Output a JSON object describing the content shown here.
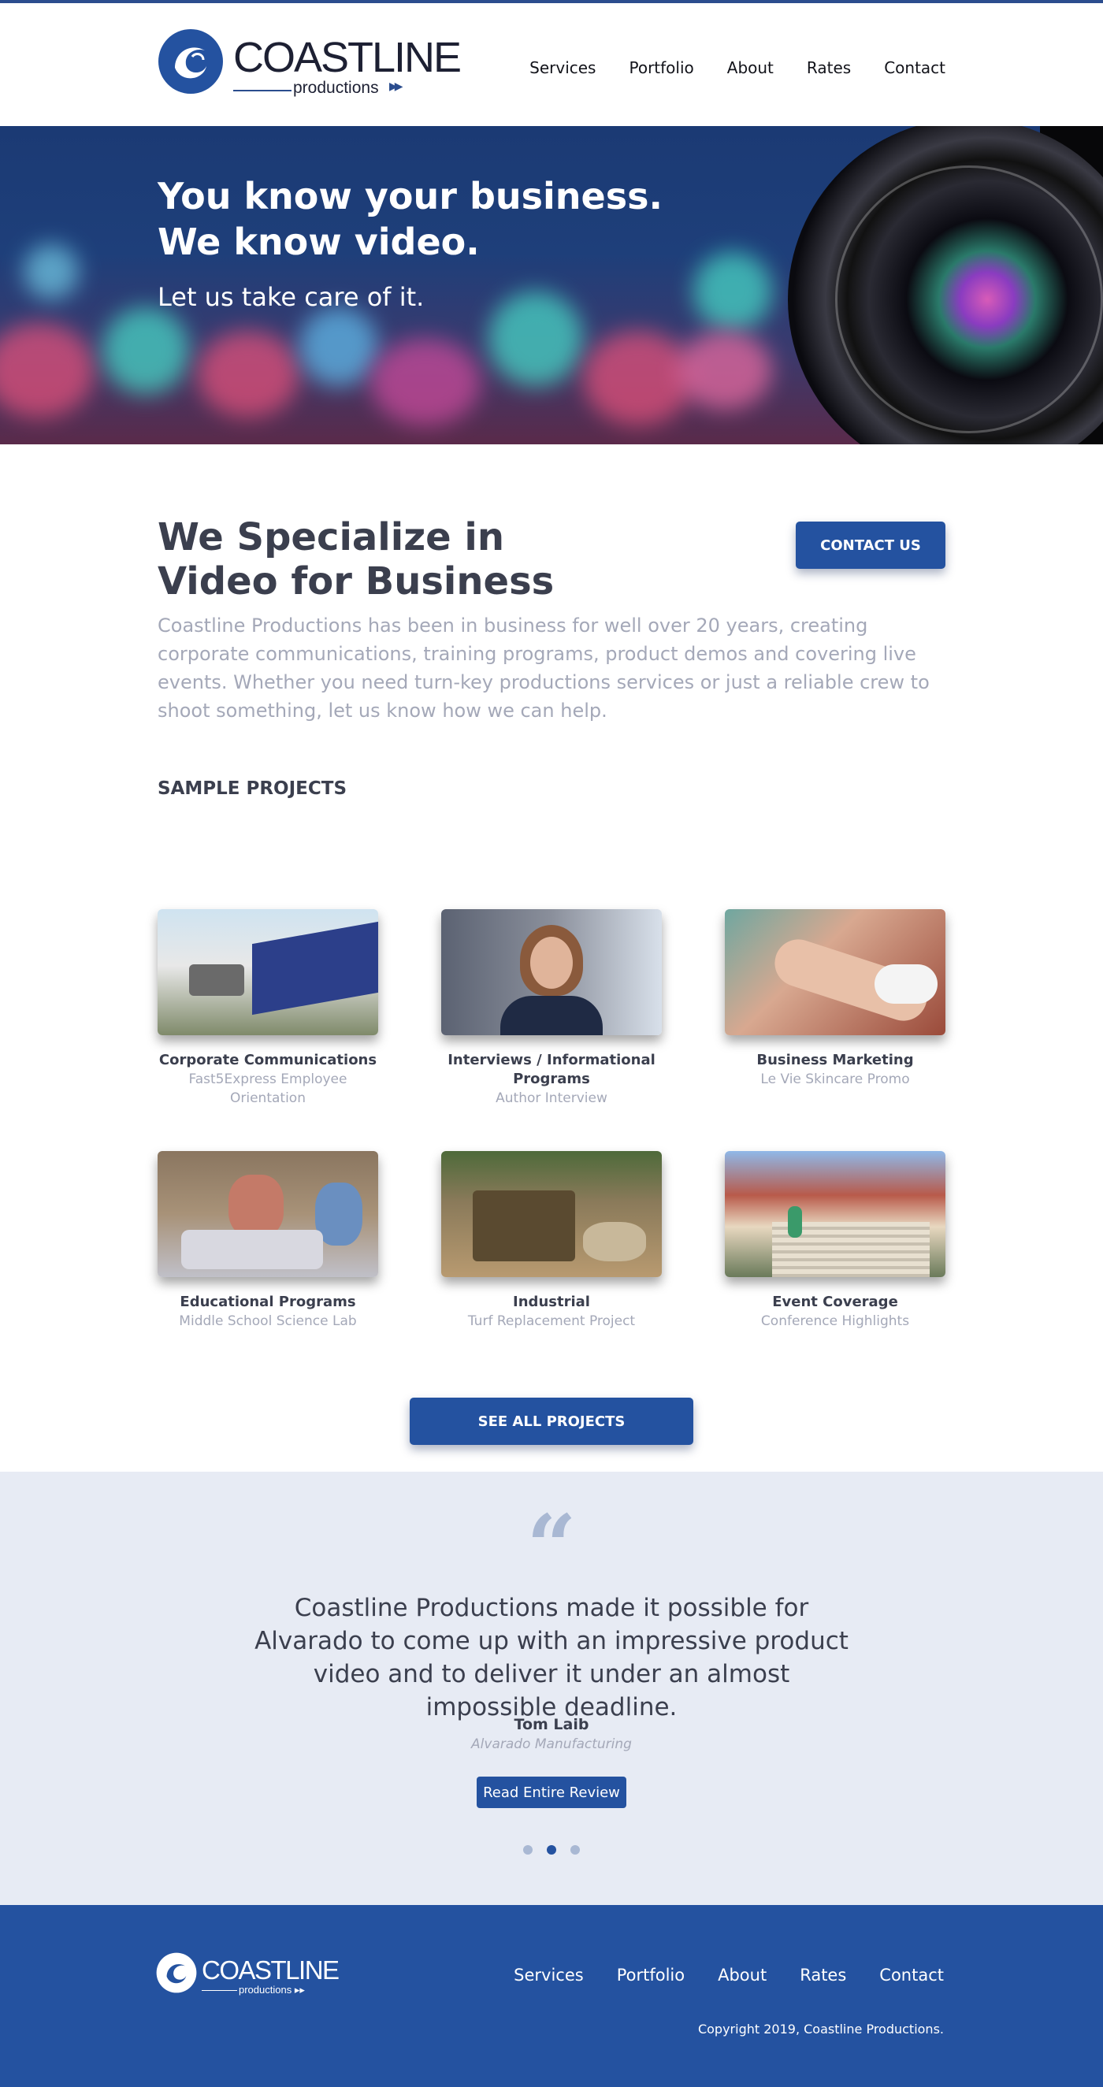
{
  "brand": {
    "name": "COASTLINE",
    "tagline": "productions",
    "accent": "#2452a0"
  },
  "nav": [
    {
      "label": "Services"
    },
    {
      "label": "Portfolio"
    },
    {
      "label": "About"
    },
    {
      "label": "Rates"
    },
    {
      "label": "Contact"
    }
  ],
  "hero": {
    "headline_line1": "You know your business.",
    "headline_line2": "We know video.",
    "subheadline": "Let us take care of it."
  },
  "specialize": {
    "title_line1": "We Specialize in",
    "title_line2": "Video for Business",
    "contact_button": "CONTACT US",
    "intro": "Coastline Productions has been in business for well over 20 years, creating corporate communications, training programs, product demos and covering live events. Whether you need turn-key productions services or just a reliable crew to shoot something, let us know how we can help."
  },
  "projects": {
    "heading": "SAMPLE PROJECTS",
    "items": [
      {
        "title": "Corporate Communications",
        "desc": "Fast5Express Employee Orientation"
      },
      {
        "title": "Interviews / Informational Programs",
        "desc": "Author Interview"
      },
      {
        "title": "Business Marketing",
        "desc": "Le Vie Skincare Promo"
      },
      {
        "title": "Educational Programs",
        "desc": "Middle School Science Lab"
      },
      {
        "title": "Industrial",
        "desc": "Turf Replacement Project"
      },
      {
        "title": "Event Coverage",
        "desc": "Conference Highlights"
      }
    ],
    "see_all": "SEE ALL PROJECTS"
  },
  "testimonial": {
    "quote": "Coastline Productions made it possible for Alvarado to come up with an impressive product video and to deliver it under an almost impossible deadline.",
    "name": "Tom Laib",
    "company": "Alvarado Manufacturing",
    "button": "Read Entire Review",
    "active_slide": 2,
    "slide_count": 3
  },
  "footer": {
    "nav": [
      {
        "label": "Services"
      },
      {
        "label": "Portfolio"
      },
      {
        "label": "About"
      },
      {
        "label": "Rates"
      },
      {
        "label": "Contact"
      }
    ],
    "copyright": "Copyright 2019, Coastline Productions."
  }
}
